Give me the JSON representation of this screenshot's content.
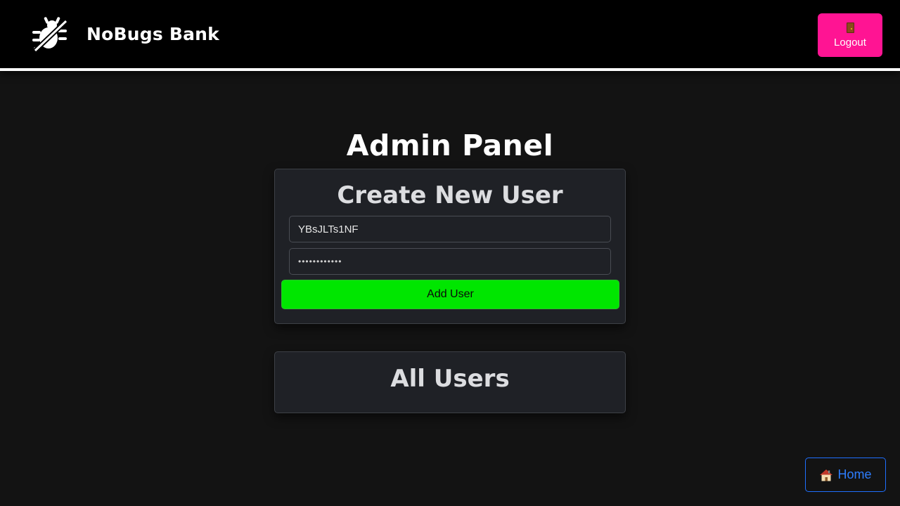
{
  "header": {
    "brand": "NoBugs Bank",
    "logo_icon": "bug-crossed-out-icon",
    "logout_icon": "door-icon",
    "logout_label": "Logout"
  },
  "main": {
    "title": "Admin Panel",
    "create_user": {
      "title": "Create New User",
      "username_value": "YBsJLTs1NF",
      "password_value": "••••••••••••",
      "add_button_label": "Add User"
    },
    "all_users": {
      "title": "All Users"
    }
  },
  "footer": {
    "home_icon": "house-icon",
    "home_label": "Home"
  },
  "colors": {
    "logout_bg": "#ff1493",
    "add_button_bg": "#00e600",
    "home_border": "#1e6fff",
    "page_bg": "#131313",
    "card_bg": "#1f2126"
  }
}
